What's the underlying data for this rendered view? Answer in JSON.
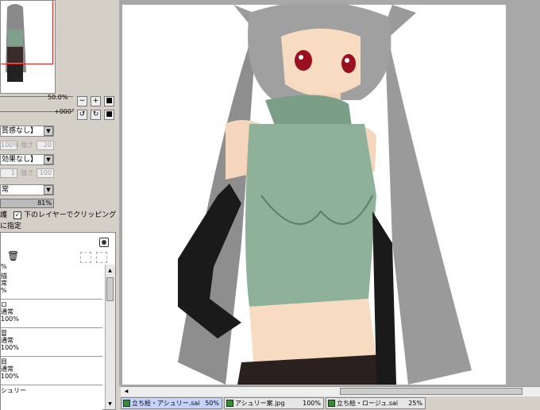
{
  "navigator": {
    "zoom_label": "50.0%",
    "rotation_label": "+000°"
  },
  "texture": {
    "label": "質感なし】",
    "scale": "100%",
    "strength_label": "強さ",
    "strength": "20"
  },
  "effect": {
    "label": "効果なし】",
    "width": "1",
    "strength_label": "強さ",
    "strength": "100"
  },
  "blend": {
    "label": "常",
    "opacity": "81%"
  },
  "options": {
    "preserve_label": "護",
    "clipping_label": "下のレイヤーでクリッピング",
    "selection_label": "に指定"
  },
  "layers": {
    "header_pct": "%",
    "items": [
      {
        "name": "描",
        "mode": "常",
        "pct": "%"
      },
      {
        "name": "ロ",
        "mode": "通常",
        "pct": "100%"
      },
      {
        "name": "冒",
        "mode": "通常",
        "pct": "100%"
      },
      {
        "name": "目",
        "mode": "通常",
        "pct": "100%"
      },
      {
        "name": "シュリー",
        "mode": "",
        "pct": ""
      }
    ]
  },
  "tabs": [
    {
      "title": "立ち絵・アシュリー.sai",
      "zoom": "50%",
      "active": true
    },
    {
      "title": "アシュリー案.jpg",
      "zoom": "100%",
      "active": false
    },
    {
      "title": "立ち絵・ロージュ.sai",
      "zoom": "25%",
      "active": false
    }
  ],
  "icons": {
    "trash": "trash-icon",
    "minus": "zoom-out-icon",
    "plus": "zoom-in-icon",
    "reset": "reset-icon",
    "rotate": "rotate-icon"
  }
}
